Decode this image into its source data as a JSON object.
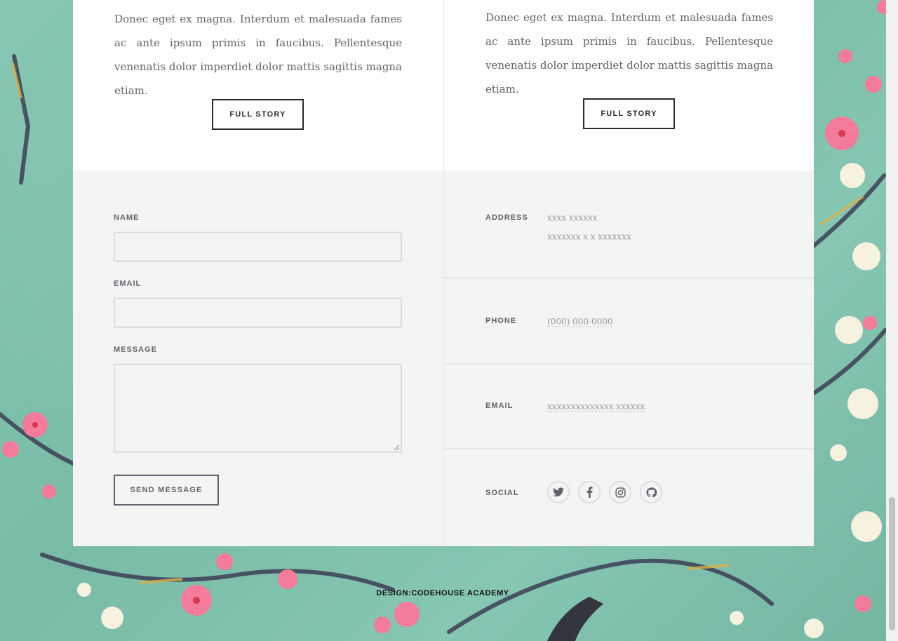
{
  "stories": [
    {
      "text": "Donec eget ex magna. Interdum et malesuada fames ac ante ipsum primis in faucibus. Pellentesque venenatis dolor imperdiet dolor mattis sagittis magna etiam.",
      "button_label": "FULL STORY"
    },
    {
      "text": "Donec eget ex magna. Interdum et malesuada fames ac ante ipsum primis in faucibus. Pellentesque venenatis dolor imperdiet dolor mattis sagittis magna etiam.",
      "button_label": "FULL STORY"
    }
  ],
  "form": {
    "name_label": "NAME",
    "name_value": "",
    "email_label": "EMAIL",
    "email_value": "",
    "message_label": "MESSAGE",
    "message_value": "",
    "submit_label": "SEND MESSAGE"
  },
  "contact": {
    "address_label": "ADDRESS",
    "address_line1": "xxxx xxxxxx",
    "address_line2": "xxxxxxx x x xxxxxxx",
    "phone_label": "PHONE",
    "phone_value": "(000) 000-0000",
    "email_label": "EMAIL",
    "email_value": "xxxxxxxxxxxxxx xxxxxx",
    "social_label": "SOCIAL",
    "social_icons": [
      "twitter-icon",
      "facebook-icon",
      "instagram-icon",
      "github-icon"
    ]
  },
  "footer": {
    "credit": "DESIGN:CODEHOUSE ACADEMY"
  },
  "colors": {
    "background_teal": "#7fc1ad",
    "panel_white": "#ffffff",
    "panel_gray": "#f4f4f4",
    "label_gray": "#5f646a",
    "text_gray": "#646464"
  }
}
